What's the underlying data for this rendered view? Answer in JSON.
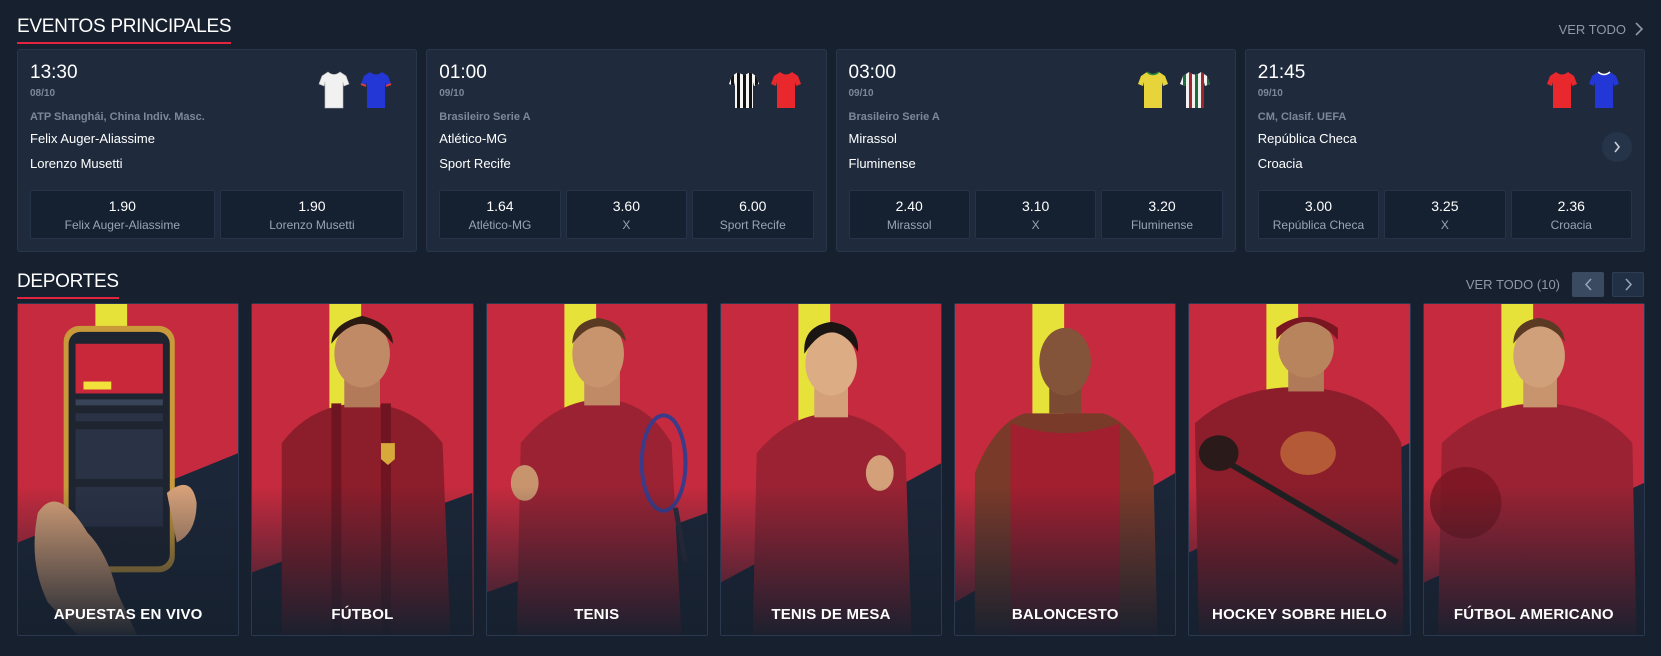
{
  "colors": {
    "accent": "#e2243f",
    "background": "#16202e",
    "card": "#1f2b3d"
  },
  "featured": {
    "title": "EVENTOS PRINCIPALES",
    "see_all": "VER TODO",
    "events": [
      {
        "time": "13:30",
        "date": "08/10",
        "league": "ATP Shanghái, China Indiv. Masc.",
        "home": "Felix Auger-Aliassime",
        "away": "Lorenzo Musetti",
        "home_kit": "white-shirt-icon",
        "away_kit": "blue-shirt-icon",
        "odds": [
          {
            "value": "1.90",
            "label": "Felix Auger-Aliassime"
          },
          {
            "value": "1.90",
            "label": "Lorenzo Musetti"
          }
        ]
      },
      {
        "time": "01:00",
        "date": "09/10",
        "league": "Brasileiro Serie A",
        "home": "Atlético-MG",
        "away": "Sport Recife",
        "home_kit": "black-white-striped-shirt-icon",
        "away_kit": "red-shirt-icon",
        "odds": [
          {
            "value": "1.64",
            "label": "Atlético-MG"
          },
          {
            "value": "3.60",
            "label": "X"
          },
          {
            "value": "6.00",
            "label": "Sport Recife"
          }
        ]
      },
      {
        "time": "03:00",
        "date": "09/10",
        "league": "Brasileiro Serie A",
        "home": "Mirassol",
        "away": "Fluminense",
        "home_kit": "yellow-shirt-icon",
        "away_kit": "green-red-striped-shirt-icon",
        "odds": [
          {
            "value": "2.40",
            "label": "Mirassol"
          },
          {
            "value": "3.10",
            "label": "X"
          },
          {
            "value": "3.20",
            "label": "Fluminense"
          }
        ]
      },
      {
        "time": "21:45",
        "date": "09/10",
        "league": "CM, Clasif. UEFA",
        "home": "República Checa",
        "away": "Croacia",
        "home_kit": "red-shirt-icon",
        "away_kit": "blue-shirt-icon",
        "odds": [
          {
            "value": "3.00",
            "label": "República Checa"
          },
          {
            "value": "3.25",
            "label": "X"
          },
          {
            "value": "2.36",
            "label": "Croacia"
          }
        ]
      }
    ]
  },
  "sports": {
    "title": "DEPORTES",
    "see_all": "VER TODO (10)",
    "items": [
      {
        "label": "APUESTAS EN VIVO"
      },
      {
        "label": "FÚTBOL"
      },
      {
        "label": "TENIS"
      },
      {
        "label": "TENIS DE MESA"
      },
      {
        "label": "BALONCESTO"
      },
      {
        "label": "HOCKEY SOBRE HIELO"
      },
      {
        "label": "FÚTBOL AMERICANO"
      }
    ]
  }
}
